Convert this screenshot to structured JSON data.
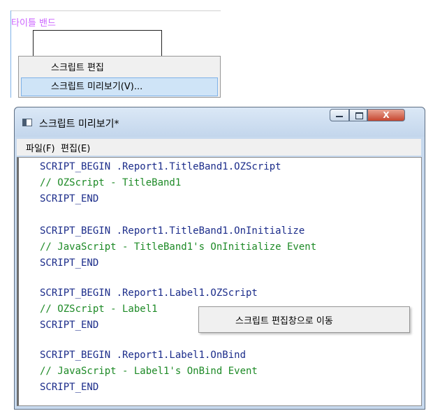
{
  "band": {
    "label": "타이틀 밴드"
  },
  "context_menu": {
    "items": [
      {
        "label": "스크립트 편집"
      },
      {
        "label": "스크립트 미리보기(V)..."
      }
    ]
  },
  "window": {
    "title": "스크립트 미리보기*",
    "close_glyph": "X",
    "menu": [
      {
        "label": "파일(F)"
      },
      {
        "label": "편집(E)"
      }
    ]
  },
  "code": {
    "lines": [
      {
        "text": "SCRIPT_BEGIN .Report1.TitleBand1.OZScript",
        "kind": "keyword"
      },
      {
        "text": "// OZScript - TitleBand1",
        "kind": "comment"
      },
      {
        "text": "SCRIPT_END",
        "kind": "keyword"
      },
      {
        "text": "SCRIPT_BEGIN .Report1.TitleBand1.OnInitialize",
        "kind": "keyword"
      },
      {
        "text": "// JavaScript - TitleBand1's OnInitialize Event",
        "kind": "comment"
      },
      {
        "text": "SCRIPT_END",
        "kind": "keyword"
      },
      {
        "text": "SCRIPT_BEGIN .Report1.Label1.OZScript",
        "kind": "keyword"
      },
      {
        "text": "// OZScript - Label1",
        "kind": "comment"
      },
      {
        "text": "SCRIPT_END",
        "kind": "keyword"
      },
      {
        "text": "SCRIPT_BEGIN .Report1.Label1.OnBind",
        "kind": "keyword"
      },
      {
        "text": "// JavaScript - Label1's OnBind Event",
        "kind": "comment"
      },
      {
        "text": "SCRIPT_END",
        "kind": "keyword"
      }
    ]
  },
  "popup": {
    "label": "스크립트 편집창으로 이동"
  },
  "colors": {
    "keyword": "#1b2c8a",
    "comment": "#1d8a26",
    "highlight": "#cfe4f7",
    "band_label": "#cc66ff"
  }
}
